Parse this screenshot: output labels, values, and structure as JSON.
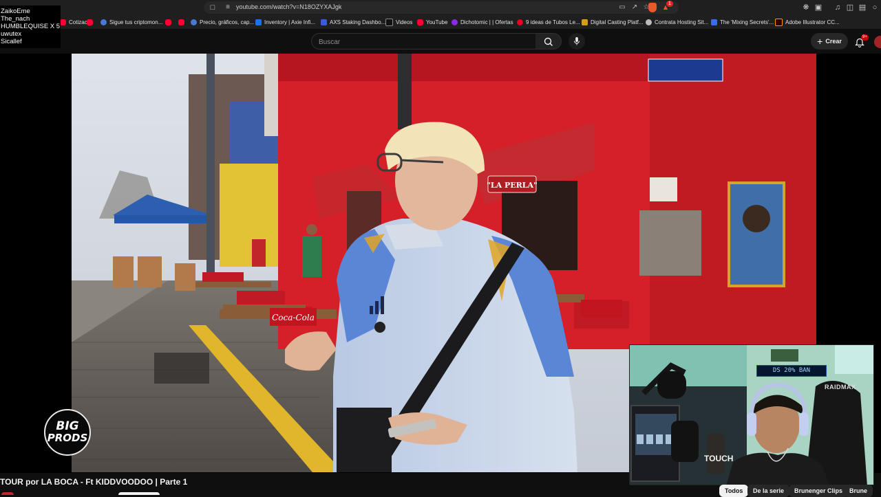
{
  "browser": {
    "url": "youtube.com/watch?v=N18OZYXAJgk",
    "extension_badge": "1",
    "bookmarks": [
      {
        "label": "Cotizac...",
        "icon": "youtube-icon"
      },
      {
        "label": "",
        "icon": "youtube-icon"
      },
      {
        "label": "Sigue tus criptomon...",
        "icon": "globe-icon"
      },
      {
        "label": "",
        "icon": "youtube-icon"
      },
      {
        "label": "",
        "icon": "youtube-icon"
      },
      {
        "label": "Precio, gráficos, cap...",
        "icon": "globe-icon"
      },
      {
        "label": "Inventory | Axie Infi...",
        "icon": "mail-icon"
      },
      {
        "label": "AXS Staking Dashbo...",
        "icon": "axs-icon"
      },
      {
        "label": "Videos",
        "icon": "video-icon"
      },
      {
        "label": "YouTube",
        "icon": "youtube-icon"
      },
      {
        "label": "Dichotomic | | Ofertas",
        "icon": "dichotomic-icon"
      },
      {
        "label": "9 ideas de Tubos Le...",
        "icon": "pinterest-icon"
      },
      {
        "label": "Digital Casting Platf...",
        "icon": "casting-icon"
      },
      {
        "label": "Contrata Hosting Sit...",
        "icon": "hosting-icon"
      },
      {
        "label": "The 'Mixing Secrets'...",
        "icon": "mixing-icon"
      },
      {
        "label": "Adobe Illustrator CC...",
        "icon": "illustrator-icon"
      }
    ]
  },
  "yt_header": {
    "search_placeholder": "Buscar",
    "create_label": "Crear",
    "notifications_badge": "9+"
  },
  "chat_overlay": {
    "names": [
      "ZaikoEme",
      "The_nach",
      "HUMBLEQUISE X 5",
      "uwutex",
      "Sicallef"
    ]
  },
  "video": {
    "title": "TOUR por LA BOCA - Ft KIDDVOODOO | Parte 1",
    "watermark_line1": "BIG",
    "watermark_line2": "PRODS",
    "scene_sign_perla": "\"LA PERLA\"",
    "scene_sign_cocacola": "Coca-Cola",
    "webcam_led_text": "DS 20% BAN",
    "webcam_chair_brand": "RAIDMAX",
    "webcam_pedal_text": "TOUCH"
  },
  "chips": [
    "Todos",
    "De la serie",
    "Brunenger Clips",
    "Brune"
  ],
  "colors": {
    "background": "#0f0f0f",
    "youtube_red": "#ff0033",
    "wall_red": "#d5202a",
    "jacket_blue": "#5b86d6"
  }
}
